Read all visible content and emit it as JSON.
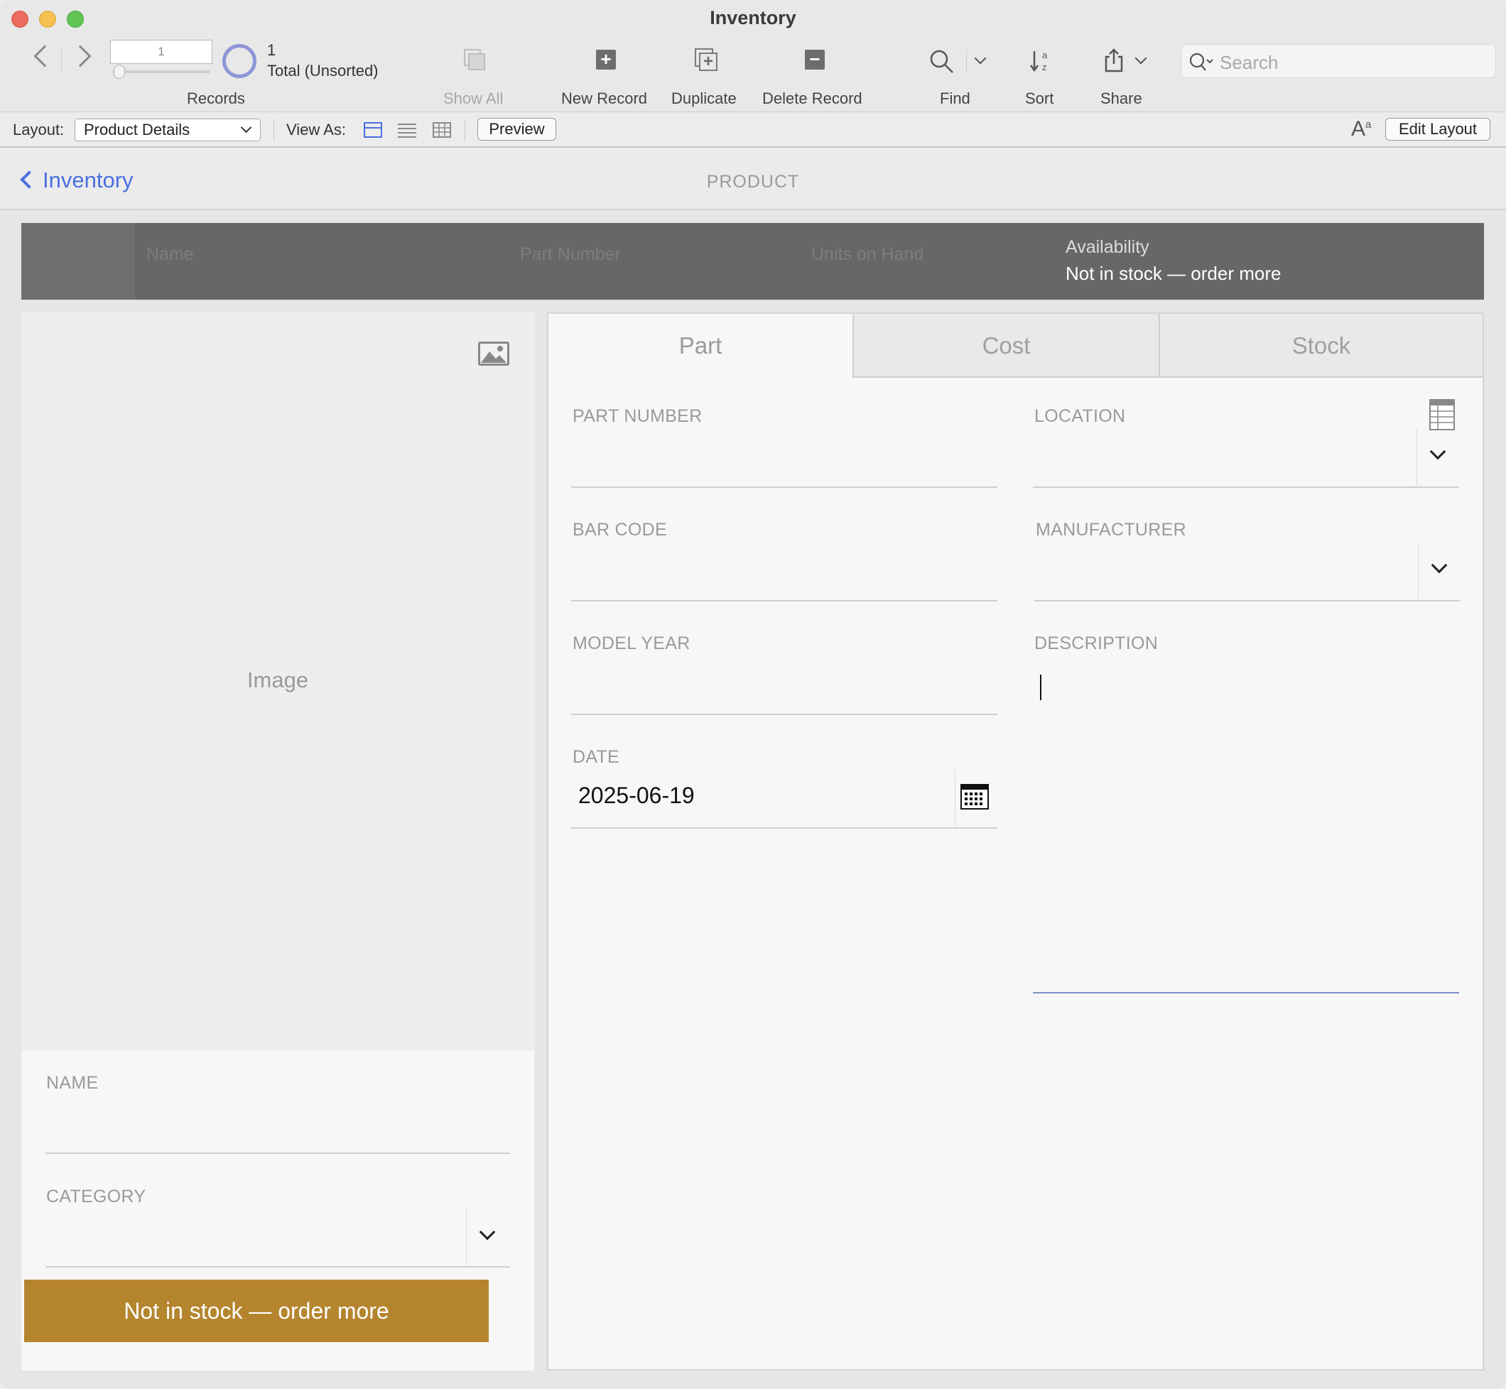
{
  "window": {
    "title": "Inventory"
  },
  "toolbar": {
    "records": {
      "current": "1",
      "count": "1",
      "total_label": "Total (Unsorted)",
      "label": "Records"
    },
    "show_all": "Show All",
    "new_record": "New Record",
    "duplicate": "Duplicate",
    "delete_record": "Delete Record",
    "find": "Find",
    "sort": "Sort",
    "share": "Share",
    "search_placeholder": "Search"
  },
  "layoutbar": {
    "layout_label": "Layout:",
    "layout_value": "Product Details",
    "view_as_label": "View As:",
    "preview": "Preview",
    "edit_layout": "Edit Layout",
    "text_size_glyph": "A",
    "text_size_super": "a"
  },
  "header": {
    "back_label": "Inventory",
    "page_title": "PRODUCT"
  },
  "list_header": {
    "columns": [
      "Name",
      "Part Number",
      "Units on Hand"
    ],
    "availability_label": "Availability",
    "availability_value": "Not in stock — order more"
  },
  "left": {
    "image_label": "Image",
    "name_label": "NAME",
    "name_value": "",
    "category_label": "CATEGORY",
    "category_value": "",
    "status_button": "Not in stock — order more"
  },
  "tabs": [
    {
      "label": "Part",
      "active": true
    },
    {
      "label": "Cost",
      "active": false
    },
    {
      "label": "Stock",
      "active": false
    }
  ],
  "part_fields": {
    "part_number": {
      "label": "PART NUMBER",
      "value": ""
    },
    "location": {
      "label": "LOCATION",
      "value": ""
    },
    "bar_code": {
      "label": "BAR CODE",
      "value": ""
    },
    "manufacturer": {
      "label": "MANUFACTURER",
      "value": ""
    },
    "model_year": {
      "label": "MODEL YEAR",
      "value": ""
    },
    "description": {
      "label": "DESCRIPTION",
      "value": ""
    },
    "date": {
      "label": "DATE",
      "value": "2025-06-19"
    }
  },
  "colors": {
    "accent_link": "#4b6fe0",
    "status_button": "#b5852e",
    "list_header_bg": "#676768",
    "records_ring": "#8e96d8"
  },
  "icons": {
    "image_placeholder": "image-icon",
    "location_picker": "table-icon",
    "date_picker": "calendar-icon",
    "find": "magnifier-icon",
    "sort": "sort-az-icon",
    "share": "share-icon"
  }
}
